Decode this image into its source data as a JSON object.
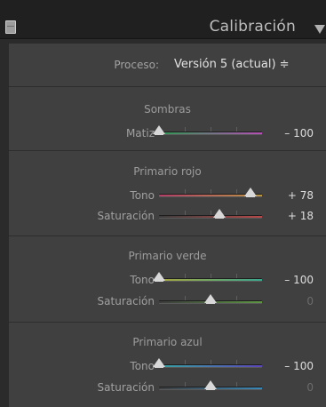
{
  "header": {
    "title": "Calibración",
    "collapse_icon": "triangle-down-icon",
    "toggle_icon": "panel-switch-icon"
  },
  "process": {
    "label": "Proceso:",
    "value": "Versión 5 (actual) ≑"
  },
  "sections": [
    {
      "title": "Sombras",
      "rows": [
        {
          "label": "Matiz",
          "value": "– 100",
          "level": 0.0,
          "track_from": "#2e9a52",
          "track_to": "#b44fb5",
          "zero": false
        }
      ]
    },
    {
      "title": "Primario rojo",
      "rows": [
        {
          "label": "Tono",
          "value": "+ 78",
          "level": 0.89,
          "track_from": "#b23c66",
          "track_to": "#b99544",
          "zero": false
        },
        {
          "label": "Saturación",
          "value": "+ 18",
          "level": 0.59,
          "track_from": "#3c3c3c",
          "track_to": "#b64848",
          "zero": false
        }
      ]
    },
    {
      "title": "Primario verde",
      "rows": [
        {
          "label": "Tono",
          "value": "– 100",
          "level": 0.0,
          "track_from": "#a7a63c",
          "track_to": "#3aa58e",
          "zero": false
        },
        {
          "label": "Saturación",
          "value": "0",
          "level": 0.5,
          "track_from": "#3c3c3c",
          "track_to": "#5e9644",
          "zero": true
        }
      ]
    },
    {
      "title": "Primario azul",
      "rows": [
        {
          "label": "Tono",
          "value": "– 100",
          "level": 0.0,
          "track_from": "#35a3a0",
          "track_to": "#5b46b8",
          "zero": false
        },
        {
          "label": "Saturación",
          "value": "0",
          "level": 0.5,
          "track_from": "#3c3c3c",
          "track_to": "#3a88b8",
          "zero": true
        }
      ]
    }
  ]
}
